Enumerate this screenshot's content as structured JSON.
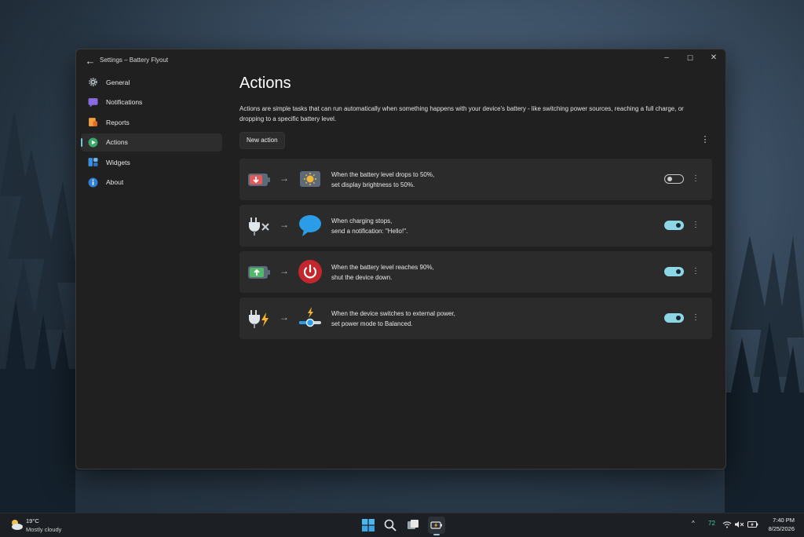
{
  "window": {
    "title": "Settings – Battery Flyout",
    "controls": {
      "minimize": "–",
      "maximize": "☐",
      "close": "✕"
    }
  },
  "sidebar": {
    "items": [
      {
        "label": "General",
        "icon": "gear-icon"
      },
      {
        "label": "Notifications",
        "icon": "notification-icon"
      },
      {
        "label": "Reports",
        "icon": "report-icon"
      },
      {
        "label": "Actions",
        "icon": "play-icon",
        "active": true
      },
      {
        "label": "Widgets",
        "icon": "widgets-icon"
      },
      {
        "label": "About",
        "icon": "info-icon"
      }
    ]
  },
  "main": {
    "title": "Actions",
    "description": "Actions are simple tasks that can run automatically when something happens with your device's battery - like switching power sources, reaching a full charge, or dropping to a specific battery level.",
    "new_action_label": "New action",
    "more_label": "⋮",
    "arrow": "→",
    "actions": [
      {
        "line1": "When the battery level drops to 50%,",
        "line2": "set display brightness to 50%.",
        "enabled": false,
        "trigger_icon": "battery-down-icon",
        "result_icon": "brightness-icon"
      },
      {
        "line1": "When charging stops,",
        "line2": "send a notification: \"Hello!\".",
        "enabled": true,
        "trigger_icon": "plug-disconnected-icon",
        "result_icon": "chat-bubble-icon"
      },
      {
        "line1": "When the battery level reaches 90%,",
        "line2": "shut the device down.",
        "enabled": true,
        "trigger_icon": "battery-up-icon",
        "result_icon": "power-icon"
      },
      {
        "line1": "When the device switches to external power,",
        "line2": "set power mode to Balanced.",
        "enabled": true,
        "trigger_icon": "plug-charging-icon",
        "result_icon": "power-mode-slider-icon"
      }
    ]
  },
  "taskbar": {
    "weather_temp": "19°C",
    "weather_desc": "Mostly cloudy",
    "tray_chevron": "^",
    "battery_percent": "72",
    "time": "7:40 PM",
    "date": "8/25/2026"
  },
  "colors": {
    "accent": "#8cd6e6",
    "window_bg": "#202020",
    "card_bg": "#2b2b2b",
    "power_red": "#c4262e",
    "bubble_blue": "#2b9de8"
  }
}
